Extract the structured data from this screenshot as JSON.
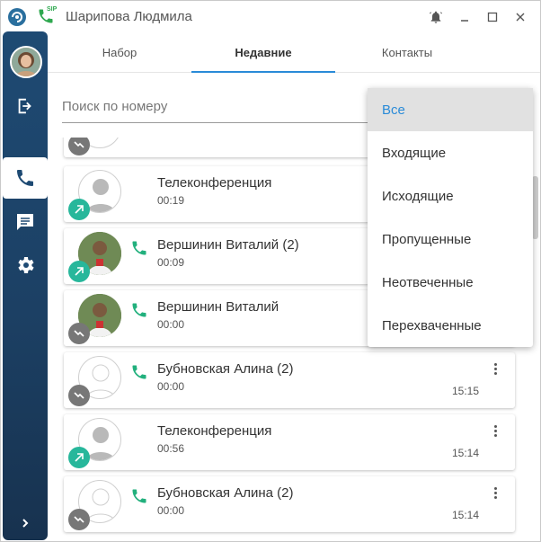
{
  "app": {
    "title": "Шарипова Людмила",
    "sip_tag": "SIP"
  },
  "tabs": [
    {
      "label": "Набор"
    },
    {
      "label": "Недавние"
    },
    {
      "label": "Контакты"
    }
  ],
  "search": {
    "placeholder": "Поиск по номеру"
  },
  "filter_menu": {
    "selected": "Все",
    "items": [
      {
        "label": "Все"
      },
      {
        "label": "Входящие"
      },
      {
        "label": "Исходящие"
      },
      {
        "label": "Пропущенные"
      },
      {
        "label": "Неотвеченные"
      },
      {
        "label": "Перехваченные"
      }
    ]
  },
  "calls": [
    {
      "name": "Телеконференция",
      "duration": "00:19",
      "time": "",
      "direction": "outgoing"
    },
    {
      "name": "Вершинин Виталий (2)",
      "duration": "00:09",
      "time": "",
      "direction": "outgoing"
    },
    {
      "name": "Вершинин Виталий",
      "duration": "00:00",
      "time": "",
      "direction": "incoming"
    },
    {
      "name": "Бубновская Алина (2)",
      "duration": "00:00",
      "time": "15:15",
      "direction": "incoming"
    },
    {
      "name": "Телеконференция",
      "duration": "00:56",
      "time": "15:14",
      "direction": "outgoing"
    },
    {
      "name": "Бубновская Алина (2)",
      "duration": "00:00",
      "time": "15:14",
      "direction": "incoming"
    }
  ],
  "colors": {
    "accent": "#2a8bd8",
    "outgoing": "#27b79b",
    "incoming": "#777777",
    "sidebar": "#1e4a73",
    "phone_green": "#22b07d"
  }
}
